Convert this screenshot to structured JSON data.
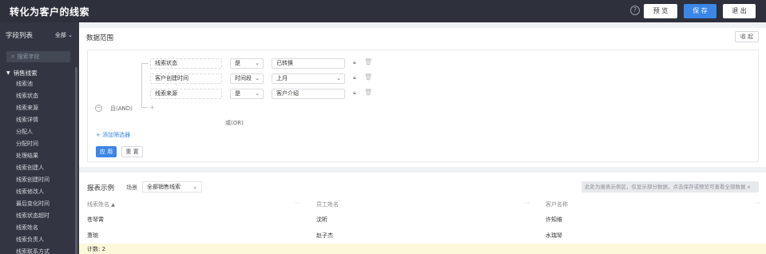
{
  "header": {
    "title": "转化为客户的线索",
    "help_icon": "?",
    "preview_label": "预 览",
    "save_label": "保 存",
    "exit_label": "退 出"
  },
  "sidebar": {
    "title": "字段列表",
    "filter_label": "全部",
    "search_placeholder": "搜索字段",
    "group_label": "销售线索",
    "items": [
      "线索池",
      "线索状态",
      "线索来源",
      "线索详情",
      "分配人",
      "分配时间",
      "处理结果",
      "线索创建人",
      "线索创建时间",
      "线索修改人",
      "最后变化时间",
      "线索状态超时",
      "线索姓名",
      "线索负责人",
      "线索联系方式"
    ]
  },
  "data_range": {
    "title": "数据范围",
    "collapse_label": "收 起",
    "and_label": "且(AND)",
    "or_label": "或(OR)",
    "conditions": [
      {
        "field": "线索状态",
        "operator": "是",
        "value": "已转换",
        "value_has_dropdown": false
      },
      {
        "field": "客户创建时间",
        "operator": "时间段",
        "value": "上月",
        "value_has_dropdown": true
      },
      {
        "field": "线索来源",
        "operator": "是",
        "value": "客户介绍",
        "value_has_dropdown": false
      }
    ],
    "add_filter_label": "+ 添加筛选器",
    "apply_label": "应 用",
    "reset_label": "重 置"
  },
  "report_example": {
    "title": "报表示例",
    "scene_label": "场景",
    "scene_value": "全部销售线索",
    "notice": "此处为报表示例区，仅显示部分数据，点击保存或预览可查看全部数据 x",
    "columns": [
      "线索姓名",
      "员工姓名",
      "客户名称"
    ],
    "rows": [
      [
        "苍琴霄",
        "沈昕",
        "许知维"
      ],
      [
        "萧琬",
        "赵子杰",
        "水瑞琴"
      ]
    ],
    "footer": "计数: 2"
  }
}
